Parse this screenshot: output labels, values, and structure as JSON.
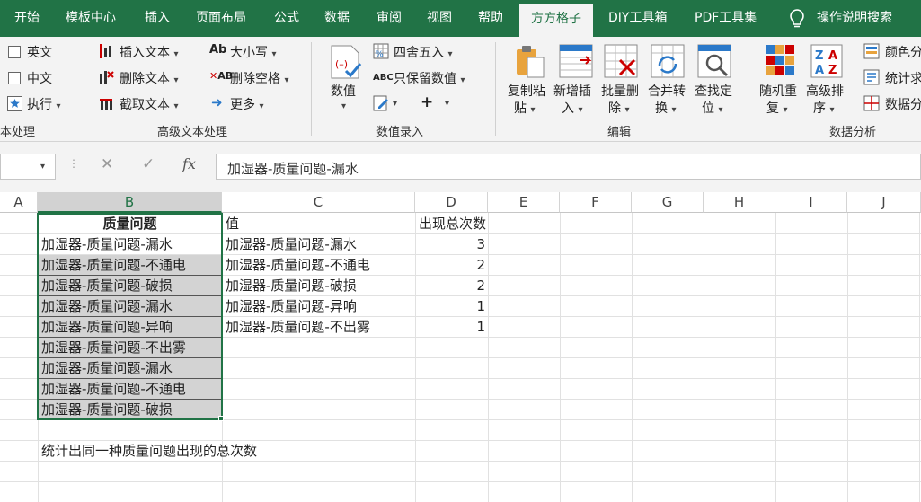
{
  "tabs": [
    "开始",
    "模板中心",
    "插入",
    "页面布局",
    "公式",
    "数据",
    "审阅",
    "视图",
    "帮助",
    "方方格子",
    "DIY工具箱",
    "PDF工具集",
    "操作说明搜索"
  ],
  "ribbon": {
    "lang": {
      "english": "英文",
      "chinese": "中文",
      "execute": "执行",
      "group": "本处理"
    },
    "advanced_text": {
      "insert_text": "插入文本",
      "delete_text": "删除文本",
      "cut_text": "截取文本",
      "case": "大小写",
      "delete_space": "删除空格",
      "more": "更多",
      "case_icon": "Ab",
      "space_icon": "AB",
      "group": "高级文本处理"
    },
    "number_entry": {
      "numeric": "数值",
      "round": "四舍五入",
      "keep_value": "只保留数值",
      "keep_icon": "ABC",
      "plus": "+",
      "group": "数值录入"
    },
    "edit": {
      "copy_paste_1": "复制粘",
      "copy_paste_2": "贴",
      "new_insert_1": "新增插",
      "new_insert_2": "入",
      "batch_delete_1": "批量删",
      "batch_delete_2": "除",
      "merge_convert_1": "合并转",
      "merge_convert_2": "换",
      "find_locate_1": "查找定",
      "find_locate_2": "位",
      "group": "编辑"
    },
    "analysis": {
      "random_dup_1": "随机重",
      "random_dup_2": "复",
      "adv_sort_1": "高级排",
      "adv_sort_2": "序",
      "color_split": "颜色分",
      "stat_find": "统计求",
      "data_split": "数据分",
      "group": "数据分析"
    }
  },
  "formula_bar": {
    "fx_symbol": "fx",
    "cancel_symbol": "✕",
    "confirm_symbol": "✓",
    "content": "加湿器-质量问题-漏水"
  },
  "columns": [
    "A",
    "B",
    "C",
    "D",
    "E",
    "F",
    "G",
    "H",
    "I",
    "J"
  ],
  "sheet": {
    "b_header": "质量问题",
    "b_values": [
      "加湿器-质量问题-漏水",
      "加湿器-质量问题-不通电",
      "加湿器-质量问题-破损",
      "加湿器-质量问题-漏水",
      "加湿器-质量问题-异响",
      "加湿器-质量问题-不出雾",
      "加湿器-质量问题-漏水",
      "加湿器-质量问题-不通电",
      "加湿器-质量问题-破损"
    ],
    "c_header": "值",
    "d_header": "出现总次数",
    "results": [
      {
        "value": "加湿器-质量问题-漏水",
        "count": "3"
      },
      {
        "value": "加湿器-质量问题-不通电",
        "count": "2"
      },
      {
        "value": "加湿器-质量问题-破损",
        "count": "2"
      },
      {
        "value": "加湿器-质量问题-异响",
        "count": "1"
      },
      {
        "value": "加湿器-质量问题-不出雾",
        "count": "1"
      }
    ],
    "note": "统计出同一种质量问题出现的总次数"
  },
  "colors": {
    "accent": "#217346",
    "selection_fill": "#d3d3d3"
  }
}
